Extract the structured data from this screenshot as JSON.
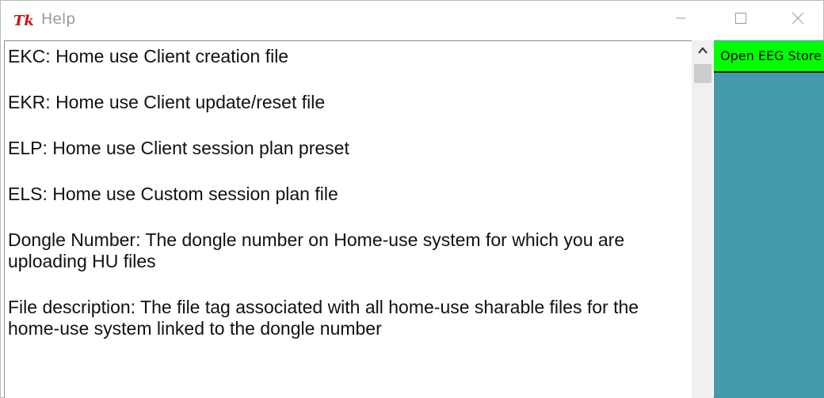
{
  "window": {
    "title": "Help",
    "icon": "tk-feather-icon"
  },
  "titlebar_controls": [
    "minimize-icon",
    "maximize-icon",
    "close-icon"
  ],
  "help_text": {
    "paragraphs": [
      [
        "EKC: Home use Client creation file"
      ],
      [
        "EKR: Home use Client update/reset file"
      ],
      [
        "ELP: Home use Client session plan preset"
      ],
      [
        "ELS: Home use Custom session plan file"
      ],
      [
        "Dongle Number: The dongle number on Home-use system for which you are",
        "uploading HU files"
      ],
      [
        "File description: The file tag associated with all home-use sharable files for the",
        "home-use system linked to the dongle number"
      ]
    ]
  },
  "right_panel": {
    "store_button_label": "Open EEG Store",
    "background_color": "#4499ab",
    "button_color": "#00ff00"
  },
  "scrollbar": {
    "up_arrow": "chevron-up-icon"
  }
}
